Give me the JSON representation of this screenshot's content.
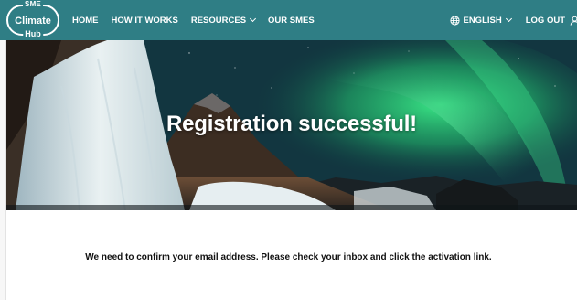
{
  "logo": {
    "line1": "SME",
    "line2": "Climate",
    "line3": "Hub"
  },
  "nav": {
    "items": [
      {
        "label": "HOME"
      },
      {
        "label": "HOW IT WORKS"
      },
      {
        "label": "RESOURCES"
      },
      {
        "label": "OUR SMES"
      }
    ],
    "language": "ENGLISH",
    "logout": "LOG OUT"
  },
  "hero": {
    "title": "Registration successful!"
  },
  "message": "We need to confirm your email address. Please check your inbox and click the activation link.",
  "colors": {
    "nav_bg": "#2f7e85",
    "text": "#111111",
    "aurora": "#2bd67a"
  },
  "icons": [
    "globe-icon",
    "chevron-down-icon",
    "user-icon"
  ]
}
